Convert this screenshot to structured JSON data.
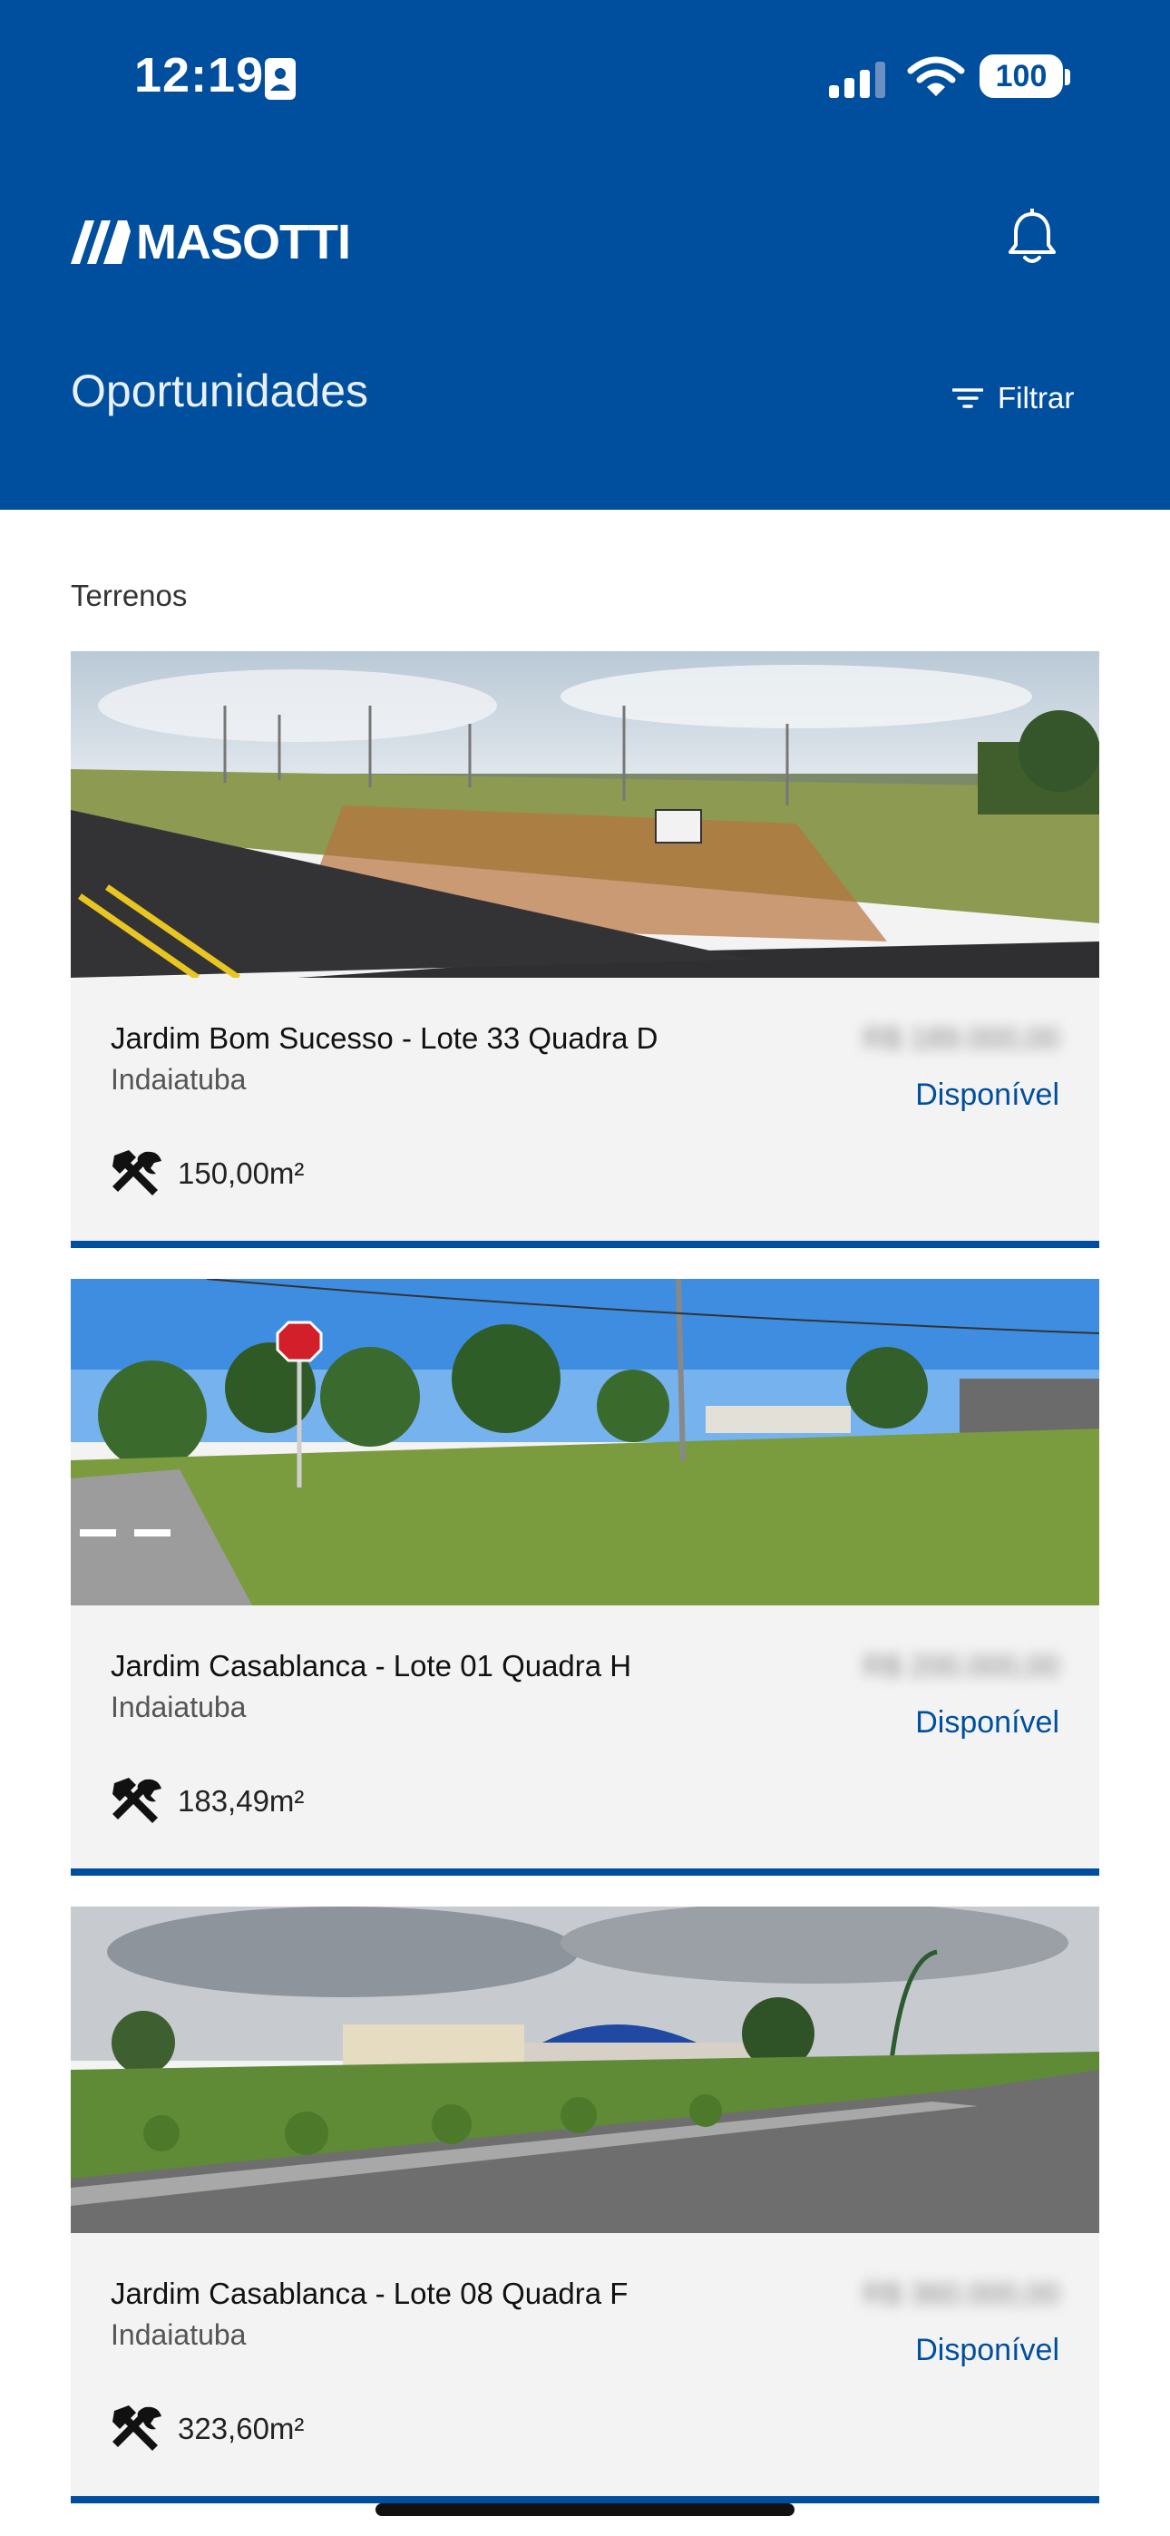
{
  "status_bar": {
    "time": "12:19",
    "battery": "100"
  },
  "header": {
    "brand": "MASOTTI",
    "title": "Oportunidades",
    "filter_label": "Filtrar"
  },
  "section": {
    "label": "Terrenos"
  },
  "listings": [
    {
      "title": "Jardim Bom Sucesso - Lote 33 Quadra D",
      "city": "Indaiatuba",
      "price": "R$ 189.000,00",
      "status": "Disponível",
      "area": "150,00m²"
    },
    {
      "title": "Jardim Casablanca - Lote 01 Quadra H",
      "city": "Indaiatuba",
      "price": "R$ 200.000,00",
      "status": "Disponível",
      "area": "183,49m²"
    },
    {
      "title": "Jardim Casablanca - Lote 08 Quadra F",
      "city": "Indaiatuba",
      "price": "R$ 360.000,00",
      "status": "Disponível",
      "area": "323,60m²"
    }
  ],
  "colors": {
    "brand_blue": "#004f9e",
    "card_bg": "#f3f3f3"
  }
}
